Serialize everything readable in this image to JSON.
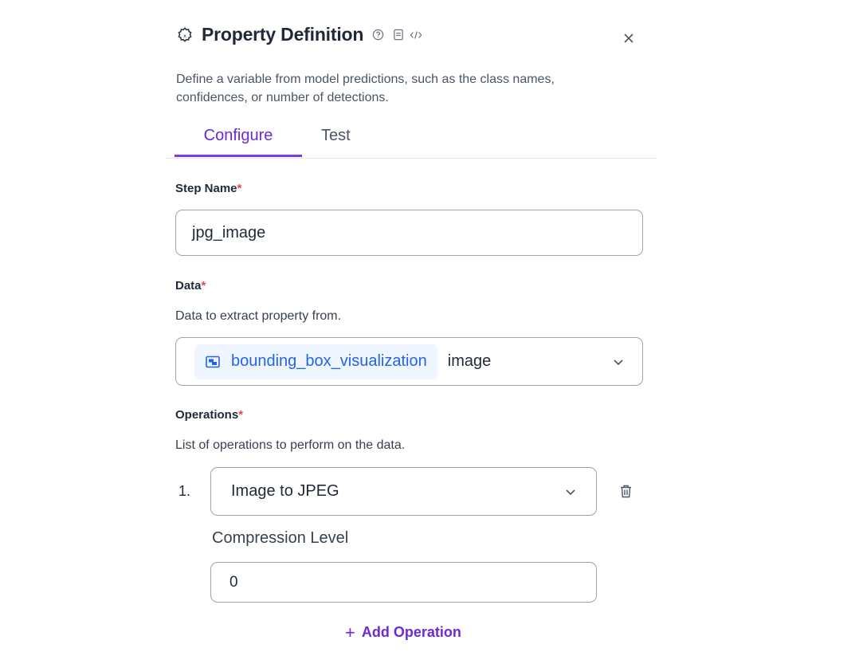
{
  "header": {
    "title": "Property Definition",
    "title_icon": "function-settings-icon",
    "help_icon": "help-circle-icon",
    "docs_icon": "document-icon",
    "code_icon": "code-icon",
    "close_icon": "close-icon"
  },
  "description": "Define a variable from model predictions, such as the class names, confidences, or number of detections.",
  "tabs": [
    {
      "label": "Configure",
      "active": true
    },
    {
      "label": "Test",
      "active": false
    }
  ],
  "step_name": {
    "label": "Step Name",
    "required_mark": "*",
    "value": "jpg_image"
  },
  "data_field": {
    "label": "Data",
    "required_mark": "*",
    "help": "Data to extract property from.",
    "chip_icon": "image-icon",
    "chip_label": "bounding_box_visualization",
    "output": "image"
  },
  "operations": {
    "label": "Operations",
    "required_mark": "*",
    "help": "List of operations to perform on the data.",
    "items": [
      {
        "number": "1.",
        "operation": "Image to JPEG",
        "param_label": "Compression Level",
        "param_value": "0"
      }
    ],
    "add_label": "Add Operation"
  },
  "colors": {
    "accent": "#7c3aed",
    "link": "#2563eb",
    "required": "#ef4444"
  }
}
